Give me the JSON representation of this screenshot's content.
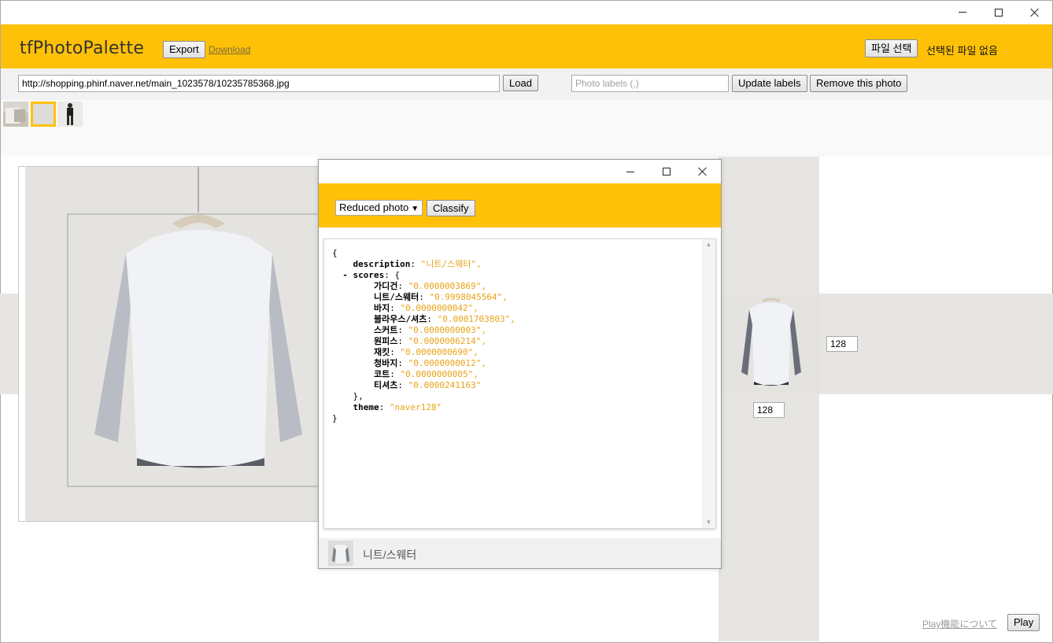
{
  "window": {
    "controls": [
      "minimize-icon",
      "maximize-icon",
      "close-icon"
    ]
  },
  "app": {
    "title": "tfPhotoPalette",
    "export_label": "Export",
    "download_label": "Download",
    "file_button_label": "파일 선택",
    "no_file_text": "선택된 파일 없음"
  },
  "toolbar": {
    "url_value": "http://shopping.phinf.naver.net/main_1023578/10235785368.jpg",
    "load_label": "Load",
    "labels_placeholder": "Photo labels (,)",
    "update_labels_label": "Update labels",
    "remove_photo_label": "Remove this photo"
  },
  "thumbnails": [
    {
      "name": "thumb-1",
      "selected": false
    },
    {
      "name": "thumb-2",
      "selected": true
    },
    {
      "name": "thumb-3",
      "selected": false
    }
  ],
  "size_inputs": {
    "below_value": "128",
    "right_value": "128"
  },
  "dialog": {
    "select_value": "Reduced photo",
    "classify_label": "Classify",
    "json_lines": [
      {
        "indent": 0,
        "text": "{"
      },
      {
        "indent": 2,
        "key": "description",
        "value": "\"니트/스웨터\","
      },
      {
        "indent": 1,
        "key": "- scores",
        "value_plain": ": {"
      },
      {
        "indent": 4,
        "key": "가디건",
        "value": "\"0.0000003869\","
      },
      {
        "indent": 4,
        "key": "니트/스웨터",
        "value": "\"0.9998045564\","
      },
      {
        "indent": 4,
        "key": "바지",
        "value": "\"0.0000000042\","
      },
      {
        "indent": 4,
        "key": "블라우스/셔츠",
        "value": "\"0.0001703803\","
      },
      {
        "indent": 4,
        "key": "스커트",
        "value": "\"0.0000000003\","
      },
      {
        "indent": 4,
        "key": "원피스",
        "value": "\"0.0000006214\","
      },
      {
        "indent": 4,
        "key": "재킷",
        "value": "\"0.0000000690\","
      },
      {
        "indent": 4,
        "key": "청바지",
        "value": "\"0.0000000012\","
      },
      {
        "indent": 4,
        "key": "코트",
        "value": "\"0.0000000005\","
      },
      {
        "indent": 4,
        "key": "티셔츠",
        "value": "\"0.0000241163\""
      },
      {
        "indent": 2,
        "text": "},"
      },
      {
        "indent": 2,
        "key": "theme",
        "value": "\"naver128\""
      },
      {
        "indent": 0,
        "text": "}"
      }
    ],
    "result_label": "니트/스웨터"
  },
  "play": {
    "about_label": "Play機能について",
    "play_label": "Play"
  },
  "colors": {
    "accent": "#ffc107",
    "json_value": "#e8a317",
    "photo_bg": "#e4e3e0"
  }
}
